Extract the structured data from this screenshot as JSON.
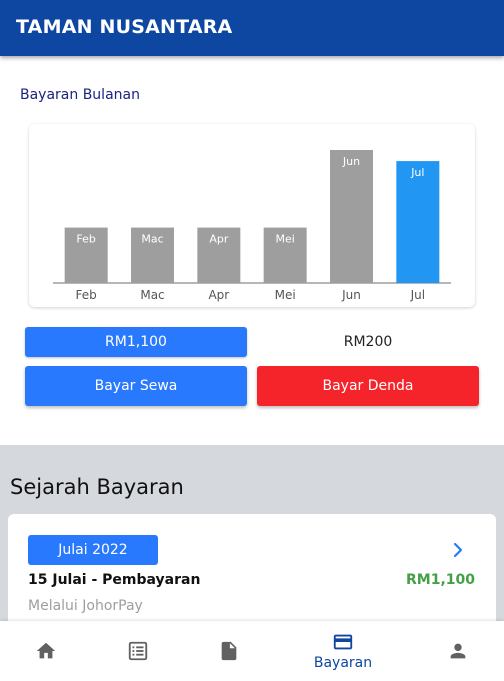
{
  "app": {
    "title": "TAMAN NUSANTARA"
  },
  "monthly": {
    "section_title": "Bayaran Bulanan"
  },
  "chart_data": {
    "type": "bar",
    "categories": [
      "Feb",
      "Mac",
      "Apr",
      "Mei",
      "Jun",
      "Jul"
    ],
    "values": [
      1,
      1,
      1,
      1,
      2.4,
      2.2
    ],
    "bar_labels": [
      "Feb",
      "Mac",
      "Apr",
      "Mei",
      "Jun",
      "Jul"
    ],
    "colors": [
      "#9e9e9e",
      "#9e9e9e",
      "#9e9e9e",
      "#9e9e9e",
      "#9e9e9e",
      "#2196f3"
    ],
    "ylim": [
      0,
      2.4
    ],
    "grid": false,
    "legend": "none"
  },
  "summary": {
    "amount_due": "RM1,100",
    "fine_amount": "RM200",
    "pay_rent_label": "Bayar Sewa",
    "pay_fine_label": "Bayar Denda"
  },
  "history": {
    "title": "Sejarah Bayaran",
    "items": [
      {
        "month": "Julai 2022",
        "title": "15 Julai - Pembayaran",
        "amount": "RM1,100",
        "method": "Melalui JohorPay"
      }
    ]
  },
  "bottom_nav": {
    "items": [
      {
        "icon": "home-icon",
        "label": ""
      },
      {
        "icon": "list-icon",
        "label": ""
      },
      {
        "icon": "document-icon",
        "label": ""
      },
      {
        "icon": "credit-card-icon",
        "label": "Bayaran",
        "active": true
      },
      {
        "icon": "person-icon",
        "label": ""
      }
    ],
    "active_color": "#0d47a1",
    "inactive_color": "#616161"
  }
}
